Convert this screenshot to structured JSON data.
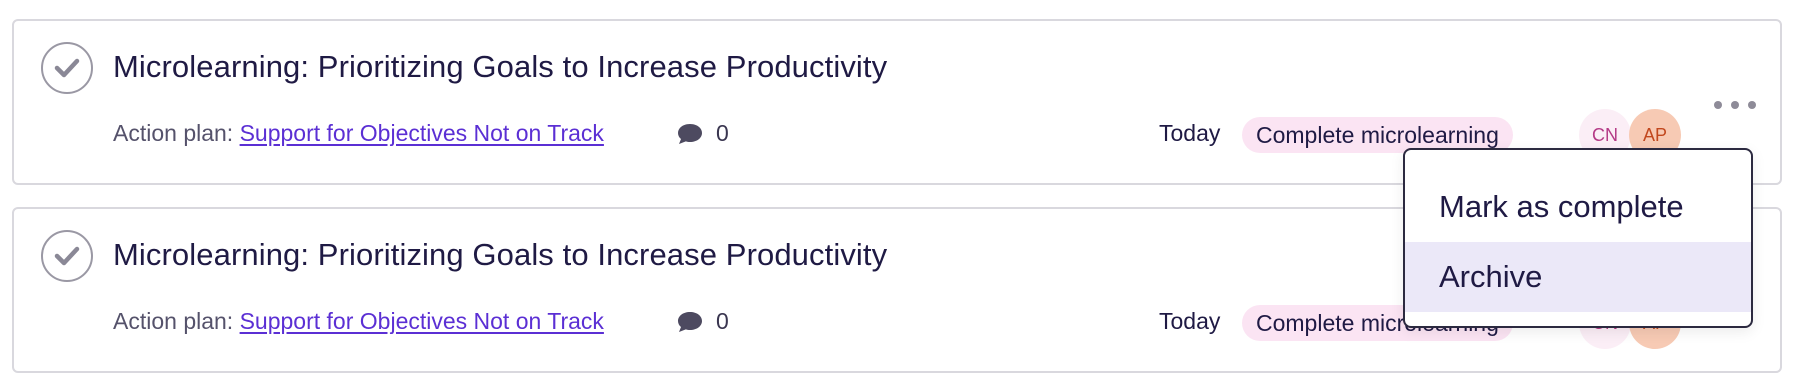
{
  "tasks": [
    {
      "title": "Microlearning: Prioritizing Goals to Increase Productivity",
      "plan_prefix": "Action plan: ",
      "plan_link": "Support for Objectives Not on Track",
      "comment_count": "0",
      "date": "Today",
      "tag": "Complete microlearning",
      "avatars": [
        "CN",
        "AP"
      ]
    },
    {
      "title": "Microlearning: Prioritizing Goals to Increase Productivity",
      "plan_prefix": "Action plan: ",
      "plan_link": "Support for Objectives Not on Track",
      "comment_count": "0",
      "date": "Today",
      "tag": "Complete microlearning",
      "avatars": [
        "CN",
        "AP"
      ]
    }
  ],
  "menu": {
    "items": [
      "Mark as complete",
      "Archive"
    ],
    "highlighted": "Archive"
  },
  "icons": {
    "complete": "checkmark-circle-icon",
    "comment": "comment-bubble-icon",
    "more": "more-horizontal-icon"
  },
  "colors": {
    "link": "#5b2fd4",
    "tag_bg": "#fbe4f3",
    "menu_highlight": "#ebe8f8"
  }
}
